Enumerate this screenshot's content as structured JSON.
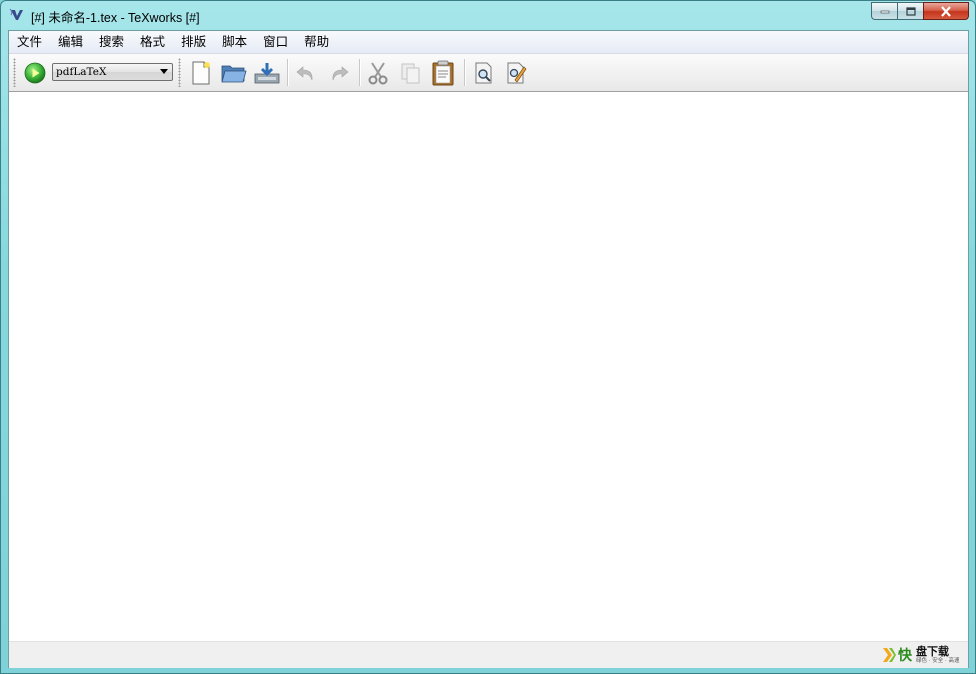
{
  "window": {
    "title": "[#] 未命名-1.tex - TeXworks [#]"
  },
  "menubar": {
    "items": [
      {
        "label": "文件"
      },
      {
        "label": "编辑"
      },
      {
        "label": "搜索"
      },
      {
        "label": "格式"
      },
      {
        "label": "排版"
      },
      {
        "label": "脚本"
      },
      {
        "label": "窗口"
      },
      {
        "label": "帮助"
      }
    ]
  },
  "toolbar": {
    "typeset_icon": "play-icon",
    "engine": "pdfLaTeX",
    "icons": [
      "new-document-icon",
      "open-folder-icon",
      "save-icon",
      "undo-icon",
      "redo-icon",
      "cut-icon",
      "copy-icon",
      "paste-icon",
      "find-icon",
      "replace-icon"
    ]
  },
  "watermark": {
    "main": "快",
    "brand": "盘下载",
    "tagline": "绿色 · 安全 · 高速"
  },
  "colors": {
    "title_bar": "#86d8dd",
    "close_button": "#c4341c",
    "run_button": "#3db43a"
  }
}
